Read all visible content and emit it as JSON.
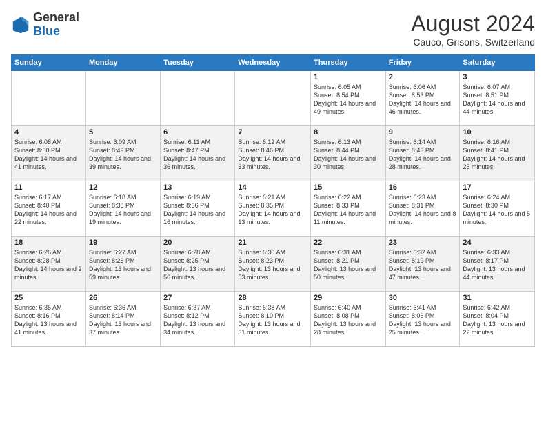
{
  "header": {
    "logo_general": "General",
    "logo_blue": "Blue",
    "month_year": "August 2024",
    "location": "Cauco, Grisons, Switzerland"
  },
  "weekdays": [
    "Sunday",
    "Monday",
    "Tuesday",
    "Wednesday",
    "Thursday",
    "Friday",
    "Saturday"
  ],
  "weeks": [
    [
      {
        "day": "",
        "info": ""
      },
      {
        "day": "",
        "info": ""
      },
      {
        "day": "",
        "info": ""
      },
      {
        "day": "",
        "info": ""
      },
      {
        "day": "1",
        "info": "Sunrise: 6:05 AM\nSunset: 8:54 PM\nDaylight: 14 hours and 49 minutes."
      },
      {
        "day": "2",
        "info": "Sunrise: 6:06 AM\nSunset: 8:53 PM\nDaylight: 14 hours and 46 minutes."
      },
      {
        "day": "3",
        "info": "Sunrise: 6:07 AM\nSunset: 8:51 PM\nDaylight: 14 hours and 44 minutes."
      }
    ],
    [
      {
        "day": "4",
        "info": "Sunrise: 6:08 AM\nSunset: 8:50 PM\nDaylight: 14 hours and 41 minutes."
      },
      {
        "day": "5",
        "info": "Sunrise: 6:09 AM\nSunset: 8:49 PM\nDaylight: 14 hours and 39 minutes."
      },
      {
        "day": "6",
        "info": "Sunrise: 6:11 AM\nSunset: 8:47 PM\nDaylight: 14 hours and 36 minutes."
      },
      {
        "day": "7",
        "info": "Sunrise: 6:12 AM\nSunset: 8:46 PM\nDaylight: 14 hours and 33 minutes."
      },
      {
        "day": "8",
        "info": "Sunrise: 6:13 AM\nSunset: 8:44 PM\nDaylight: 14 hours and 30 minutes."
      },
      {
        "day": "9",
        "info": "Sunrise: 6:14 AM\nSunset: 8:43 PM\nDaylight: 14 hours and 28 minutes."
      },
      {
        "day": "10",
        "info": "Sunrise: 6:16 AM\nSunset: 8:41 PM\nDaylight: 14 hours and 25 minutes."
      }
    ],
    [
      {
        "day": "11",
        "info": "Sunrise: 6:17 AM\nSunset: 8:40 PM\nDaylight: 14 hours and 22 minutes."
      },
      {
        "day": "12",
        "info": "Sunrise: 6:18 AM\nSunset: 8:38 PM\nDaylight: 14 hours and 19 minutes."
      },
      {
        "day": "13",
        "info": "Sunrise: 6:19 AM\nSunset: 8:36 PM\nDaylight: 14 hours and 16 minutes."
      },
      {
        "day": "14",
        "info": "Sunrise: 6:21 AM\nSunset: 8:35 PM\nDaylight: 14 hours and 13 minutes."
      },
      {
        "day": "15",
        "info": "Sunrise: 6:22 AM\nSunset: 8:33 PM\nDaylight: 14 hours and 11 minutes."
      },
      {
        "day": "16",
        "info": "Sunrise: 6:23 AM\nSunset: 8:31 PM\nDaylight: 14 hours and 8 minutes."
      },
      {
        "day": "17",
        "info": "Sunrise: 6:24 AM\nSunset: 8:30 PM\nDaylight: 14 hours and 5 minutes."
      }
    ],
    [
      {
        "day": "18",
        "info": "Sunrise: 6:26 AM\nSunset: 8:28 PM\nDaylight: 14 hours and 2 minutes."
      },
      {
        "day": "19",
        "info": "Sunrise: 6:27 AM\nSunset: 8:26 PM\nDaylight: 13 hours and 59 minutes."
      },
      {
        "day": "20",
        "info": "Sunrise: 6:28 AM\nSunset: 8:25 PM\nDaylight: 13 hours and 56 minutes."
      },
      {
        "day": "21",
        "info": "Sunrise: 6:30 AM\nSunset: 8:23 PM\nDaylight: 13 hours and 53 minutes."
      },
      {
        "day": "22",
        "info": "Sunrise: 6:31 AM\nSunset: 8:21 PM\nDaylight: 13 hours and 50 minutes."
      },
      {
        "day": "23",
        "info": "Sunrise: 6:32 AM\nSunset: 8:19 PM\nDaylight: 13 hours and 47 minutes."
      },
      {
        "day": "24",
        "info": "Sunrise: 6:33 AM\nSunset: 8:17 PM\nDaylight: 13 hours and 44 minutes."
      }
    ],
    [
      {
        "day": "25",
        "info": "Sunrise: 6:35 AM\nSunset: 8:16 PM\nDaylight: 13 hours and 41 minutes."
      },
      {
        "day": "26",
        "info": "Sunrise: 6:36 AM\nSunset: 8:14 PM\nDaylight: 13 hours and 37 minutes."
      },
      {
        "day": "27",
        "info": "Sunrise: 6:37 AM\nSunset: 8:12 PM\nDaylight: 13 hours and 34 minutes."
      },
      {
        "day": "28",
        "info": "Sunrise: 6:38 AM\nSunset: 8:10 PM\nDaylight: 13 hours and 31 minutes."
      },
      {
        "day": "29",
        "info": "Sunrise: 6:40 AM\nSunset: 8:08 PM\nDaylight: 13 hours and 28 minutes."
      },
      {
        "day": "30",
        "info": "Sunrise: 6:41 AM\nSunset: 8:06 PM\nDaylight: 13 hours and 25 minutes."
      },
      {
        "day": "31",
        "info": "Sunrise: 6:42 AM\nSunset: 8:04 PM\nDaylight: 13 hours and 22 minutes."
      }
    ]
  ]
}
